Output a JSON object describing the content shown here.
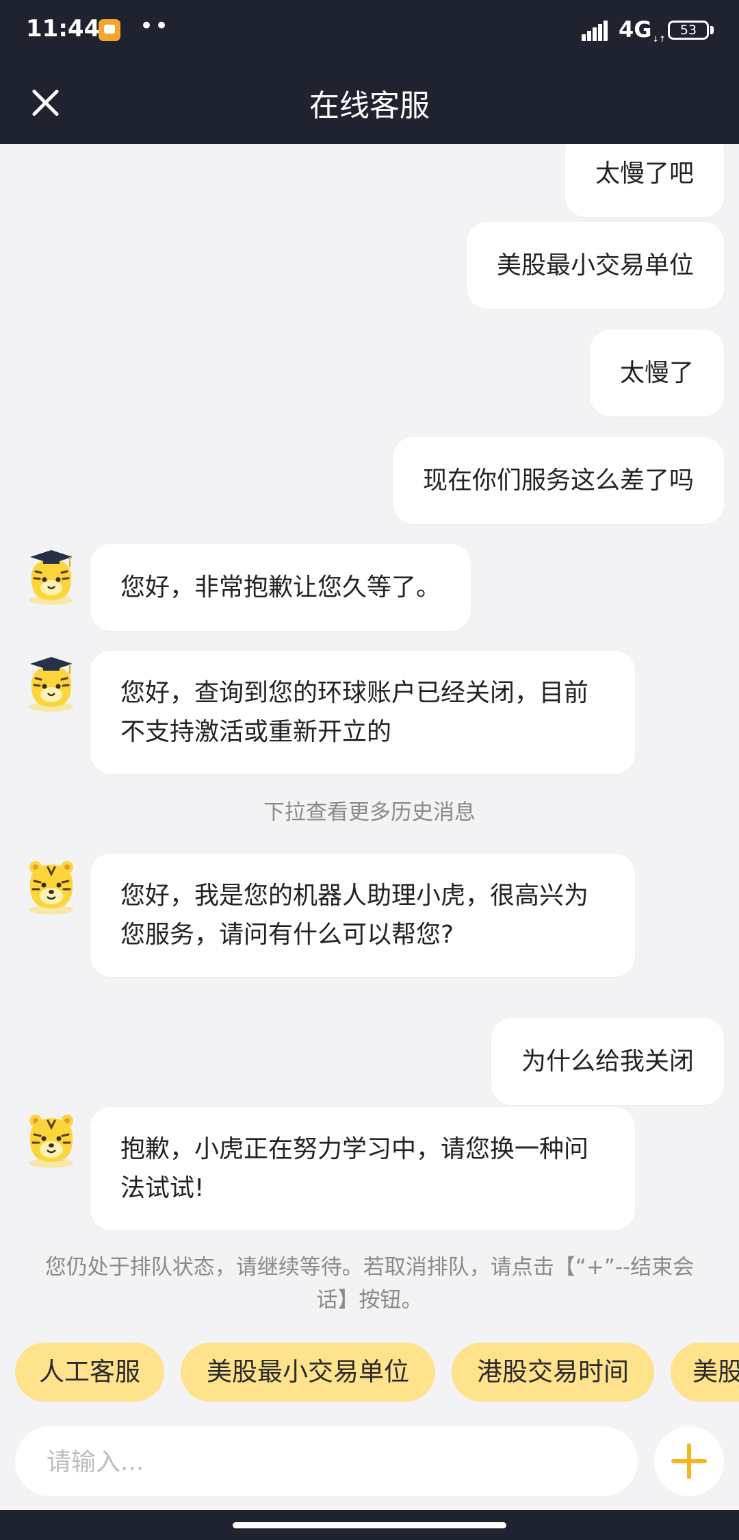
{
  "status_bar": {
    "time": "11:44",
    "dots": "••",
    "network": "4G",
    "network_arrows": "↓↑",
    "battery": "53"
  },
  "header": {
    "title": "在线客服"
  },
  "messages": [
    {
      "side": "right",
      "text": "太慢了吧"
    },
    {
      "side": "right",
      "text": "美股最小交易单位"
    },
    {
      "side": "right",
      "text": "太慢了"
    },
    {
      "side": "right",
      "text": "现在你们服务这么差了吗"
    },
    {
      "side": "left",
      "avatar": "tiger-graduate-avatar",
      "text": "您好，非常抱歉让您久等了。"
    },
    {
      "side": "left",
      "avatar": "tiger-graduate-avatar",
      "text": "您好，查询到您的环球账户已经关闭，目前不支持激活或重新开立的"
    },
    {
      "type": "system",
      "text": "下拉查看更多历史消息"
    },
    {
      "side": "left",
      "avatar": "tiger-bot-avatar",
      "text": "您好，我是您的机器人助理小虎，很高兴为您服务，请问有什么可以帮您?"
    },
    {
      "side": "right",
      "text": "为什么给我关闭"
    },
    {
      "side": "left",
      "avatar": "tiger-bot-avatar",
      "text": "抱歉，小虎正在努力学习中，请您换一种问法试试!"
    },
    {
      "type": "system",
      "text": "您仍处于排队状态，请继续等待。若取消排队，请点击【“+”--结束会话】按钮。"
    }
  ],
  "quick_replies": [
    "人工客服",
    "美股最小交易单位",
    "港股交易时间",
    "美股"
  ],
  "input": {
    "placeholder": "请输入..."
  },
  "colors": {
    "header_bg": "#1f2330",
    "chat_bg": "#f3f3f5",
    "chip_bg": "#ffe28c",
    "accent": "#f5b51d"
  }
}
